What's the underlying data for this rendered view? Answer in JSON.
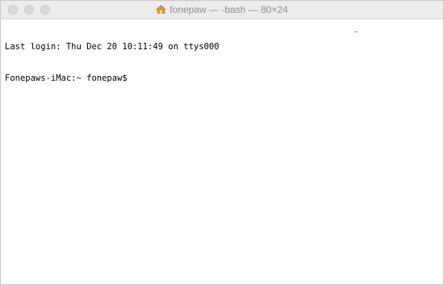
{
  "window": {
    "title": "fonepaw — -bash — 80×24",
    "title_icon": "home-folder-icon"
  },
  "controls": {
    "close_icon": "close-icon",
    "minimize_icon": "minimize-icon",
    "zoom_icon": "zoom-icon"
  },
  "terminal": {
    "lines": [
      "Last login: Thu Dec 20 10:11:49 on ttys000",
      "Fonepaws-iMac:~ fonepaw$ "
    ]
  },
  "colors": {
    "titlebar": "#ececec",
    "title_text": "#8f8f8f",
    "traffic_light": "#d9d9d9",
    "terminal_background": "#ffffff",
    "terminal_text": "#000000",
    "home_icon": "#d29a4a"
  }
}
